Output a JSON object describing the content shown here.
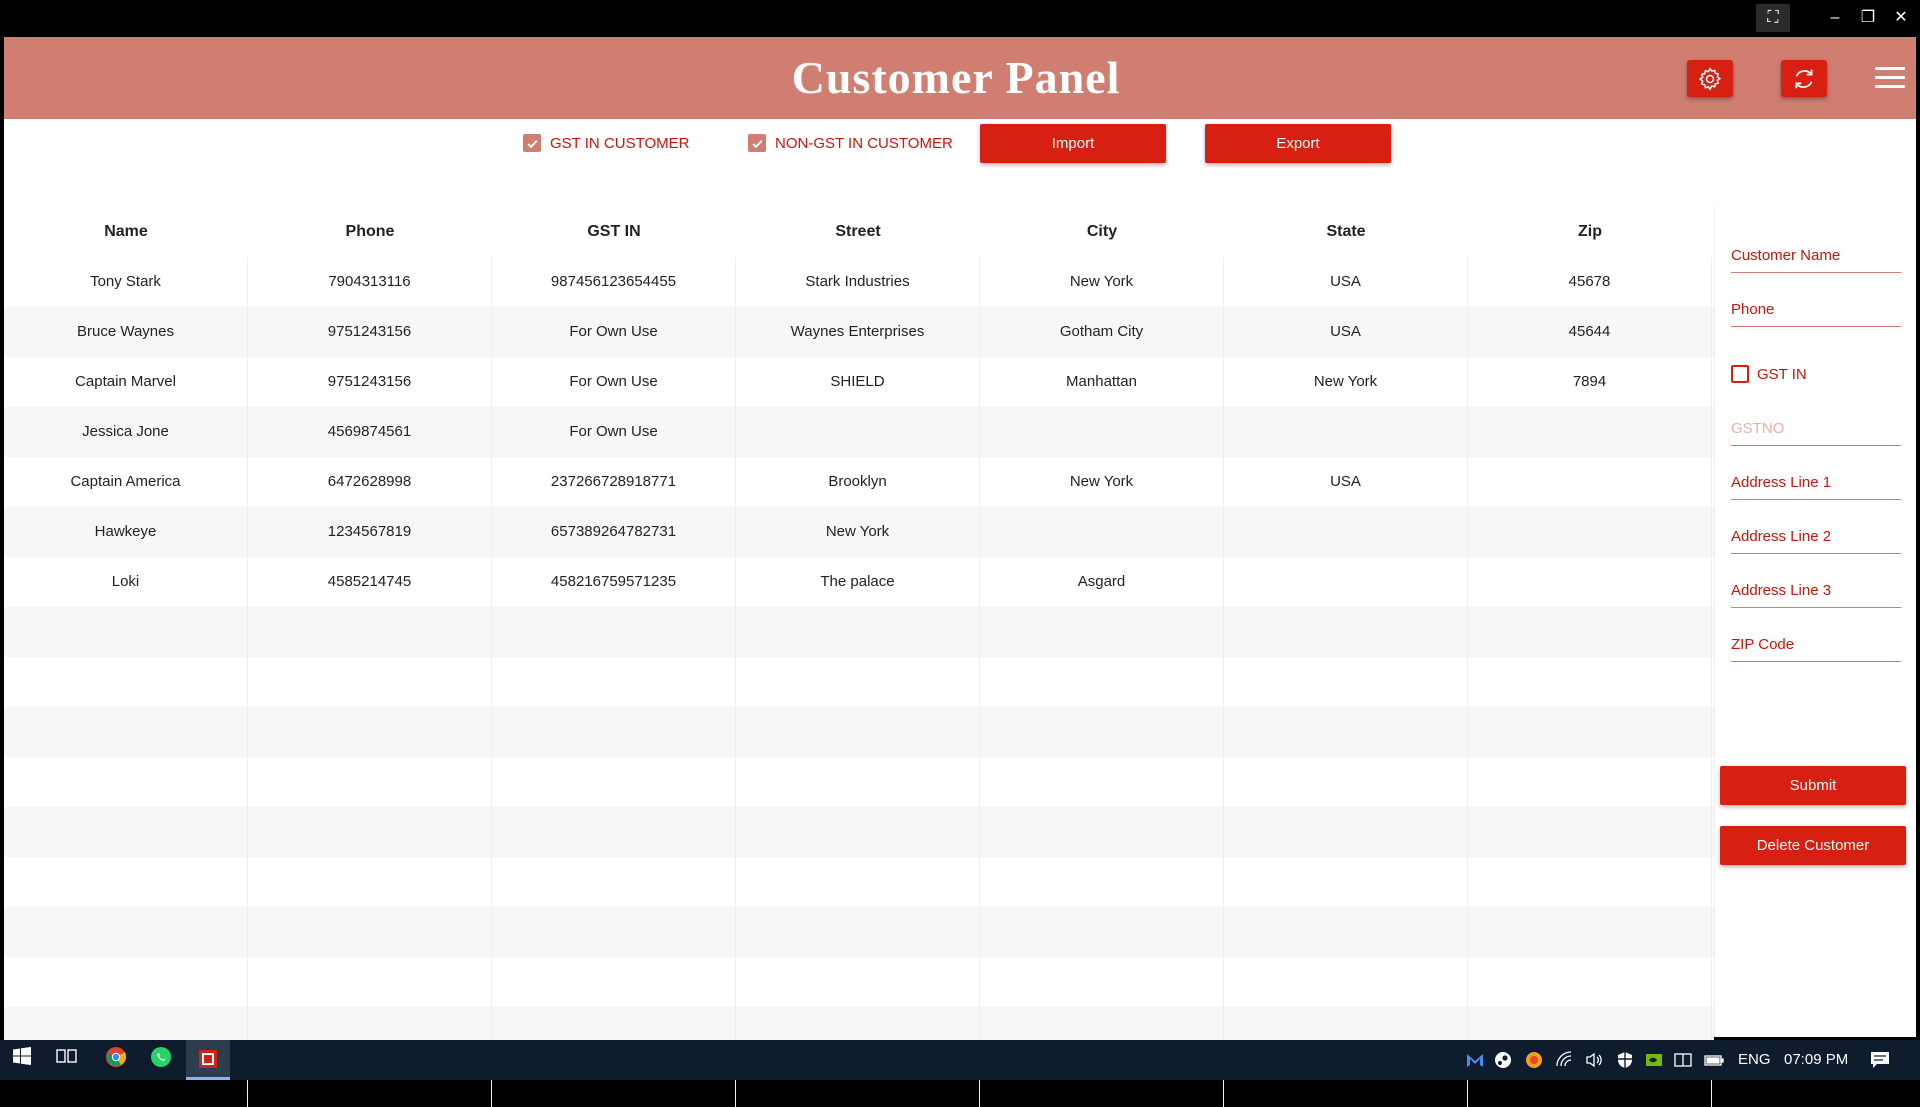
{
  "window": {
    "fullscreen_icon": "fullscreen-icon",
    "minimize_icon": "minimize-icon",
    "restore_icon": "restore-icon",
    "close_icon": "close-icon"
  },
  "header": {
    "title": "Customer Panel",
    "settings_icon": "gear-icon",
    "refresh_icon": "refresh-icon",
    "menu_icon": "hamburger-menu-icon"
  },
  "toolbar": {
    "gst_checkbox_label": "GST IN CUSTOMER",
    "gst_checked": true,
    "nongst_checkbox_label": "NON-GST IN CUSTOMER",
    "nongst_checked": true,
    "import_label": "Import",
    "export_label": "Export"
  },
  "table": {
    "headers": [
      "Name",
      "Phone",
      "GST IN",
      "Street",
      "City",
      "State",
      "Zip"
    ],
    "rows": [
      [
        "Tony Stark",
        "7904313116",
        "987456123654455",
        "Stark Industries",
        "New York",
        "USA",
        "45678"
      ],
      [
        "Bruce Waynes",
        "9751243156",
        "For Own Use",
        "Waynes Enterprises",
        "Gotham City",
        "USA",
        "45644"
      ],
      [
        "Captain Marvel",
        "9751243156",
        "For Own Use",
        "SHIELD",
        "Manhattan",
        "New York",
        "7894"
      ],
      [
        "Jessica Jone",
        "4569874561",
        "For Own Use",
        "",
        "",
        "",
        ""
      ],
      [
        "Captain America",
        "6472628998",
        "237266728918771",
        "Brooklyn",
        "New York",
        "USA",
        ""
      ],
      [
        "Hawkeye",
        "1234567819",
        "657389264782731",
        "New York",
        "",
        "",
        ""
      ],
      [
        "Loki",
        "4585214745",
        "458216759571235",
        "The palace",
        "Asgard",
        "",
        ""
      ]
    ]
  },
  "form": {
    "customer_name_placeholder": "Customer Name",
    "phone_placeholder": "Phone",
    "gst_in_label": "GST IN",
    "gst_in_checked": false,
    "gstno_placeholder": "GSTNO",
    "address1_placeholder": "Address Line 1",
    "address2_placeholder": "Address Line 2",
    "address3_placeholder": "Address Line 3",
    "zip_placeholder": "ZIP Code",
    "submit_label": "Submit",
    "delete_label": "Delete Customer"
  },
  "taskbar": {
    "language": "ENG",
    "time": "07:09 PM"
  },
  "colors": {
    "header_bg": "#d07e72",
    "accent_red": "#d71f12",
    "text_red": "#c8160d"
  }
}
